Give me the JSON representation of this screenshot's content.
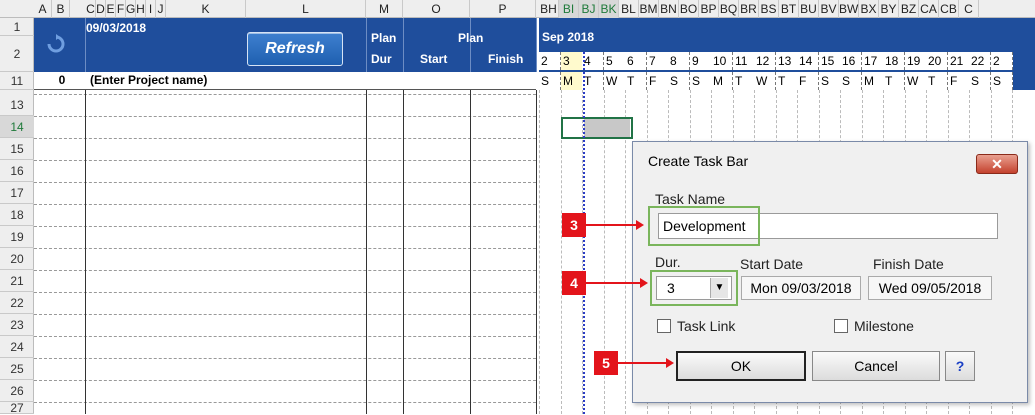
{
  "column_headers": [
    "A",
    "B",
    "C",
    "D",
    "E",
    "F",
    "G",
    "H",
    "I",
    "J",
    "K",
    "L",
    "M",
    "O",
    "P",
    "BH",
    "BI",
    "BJ",
    "BK",
    "BL",
    "BM",
    "BN",
    "BO",
    "BP",
    "BQ",
    "BR",
    "BS",
    "BT",
    "BU",
    "BV",
    "BW",
    "BX",
    "BY",
    "BZ",
    "CA",
    "CB",
    "C"
  ],
  "row_headers": [
    "1",
    "2",
    "11",
    "13",
    "14",
    "15",
    "16",
    "17",
    "18",
    "19",
    "20",
    "21",
    "22",
    "23",
    "24",
    "25",
    "26",
    "27"
  ],
  "sheet": {
    "date": "09/03/2018",
    "refresh_label": "Refresh",
    "plan_dur_line1": "Plan",
    "plan_dur_line2": "Dur",
    "plan_label": "Plan",
    "start_label": "Start",
    "finish_label": "Finish",
    "project_number": "0",
    "project_name": "(Enter Project name)"
  },
  "gantt": {
    "month": "Sep 2018",
    "days": [
      "2",
      "3",
      "4",
      "5",
      "6",
      "7",
      "8",
      "9",
      "10",
      "11",
      "12",
      "13",
      "14",
      "15",
      "16",
      "17",
      "18",
      "19",
      "20",
      "21",
      "22",
      "2"
    ],
    "weekdays": [
      "S",
      "M",
      "T",
      "W",
      "T",
      "F",
      "S",
      "S",
      "M",
      "T",
      "W",
      "T",
      "F",
      "S",
      "S",
      "M",
      "T",
      "W",
      "T",
      "F",
      "S",
      "S"
    ]
  },
  "dialog": {
    "title": "Create Task Bar",
    "close_label": "✕",
    "task_name_label": "Task Name",
    "task_name_value": "Development",
    "dur_label": "Dur.",
    "dur_value": "3",
    "start_date_label": "Start Date",
    "start_date_value": "Mon 09/03/2018",
    "finish_date_label": "Finish Date",
    "finish_date_value": "Wed 09/05/2018",
    "task_link_label": "Task Link",
    "milestone_label": "Milestone",
    "ok_label": "OK",
    "cancel_label": "Cancel",
    "help_label": "?"
  },
  "callouts": {
    "c3": "3",
    "c4": "4",
    "c5": "5"
  },
  "colors": {
    "header_blue": "#1f4e9c",
    "callout_red": "#e3141b",
    "highlight_green": "#7ab55c",
    "today_line": "#2a3cc4"
  }
}
